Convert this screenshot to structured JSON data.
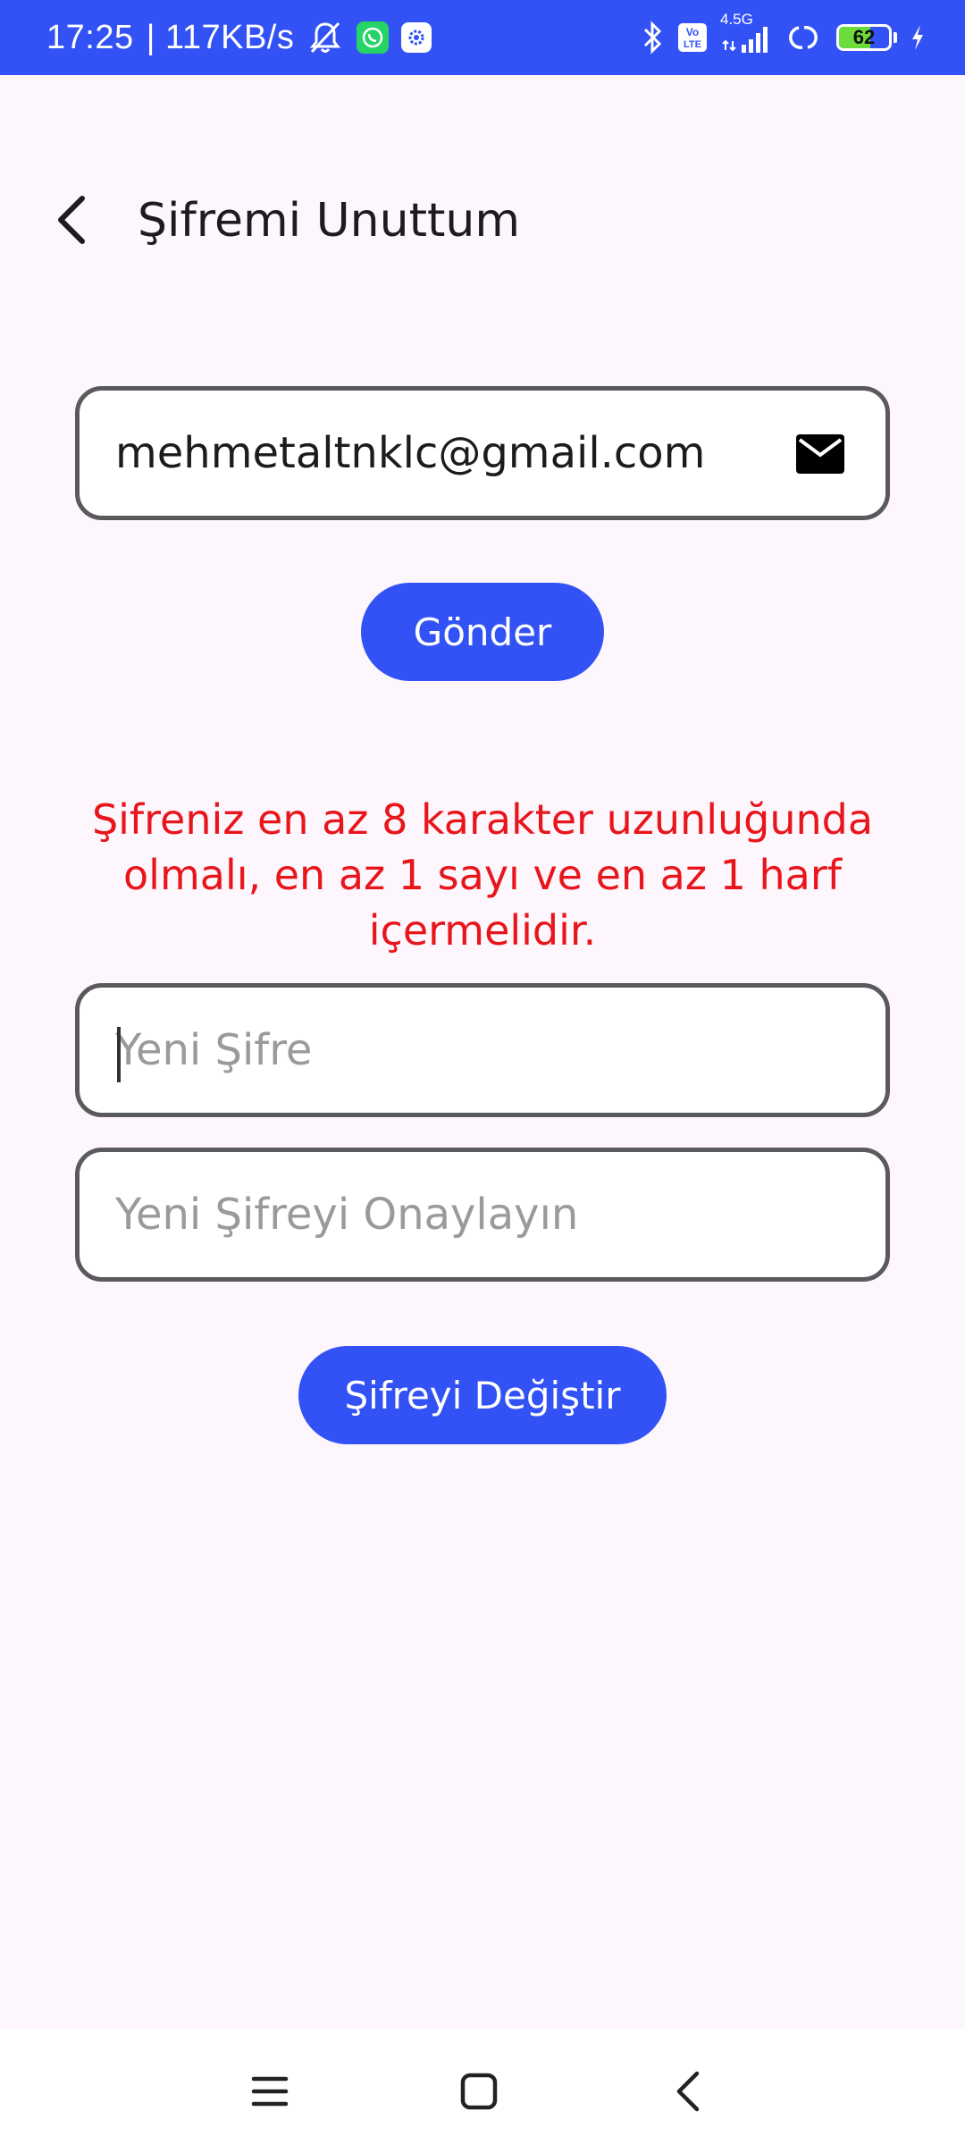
{
  "status_bar": {
    "time": "17:25",
    "speed": "| 117KB/s",
    "network": "4.5G",
    "volte": "Vo LTE",
    "battery": "62",
    "battery_level": 0.62
  },
  "app_bar": {
    "title": "Şifremi Unuttum"
  },
  "email": {
    "value": "mehmetaltnklc@gmail.com",
    "placeholder": ""
  },
  "send_button": "Gönder",
  "password_rule": "Şifreniz en az 8 karakter uzunluğunda olmalı, en az 1 sayı ve en az 1 harf içermelidir.",
  "new_password": {
    "value": "",
    "placeholder": "Yeni Şifre"
  },
  "confirm_password": {
    "value": "",
    "placeholder": "Yeni Şifreyi Onaylayın"
  },
  "change_button": "Şifreyi Değiştir",
  "colors": {
    "primary": "#3252f5",
    "warning": "#e8151b",
    "background": "#fdf6fd"
  }
}
